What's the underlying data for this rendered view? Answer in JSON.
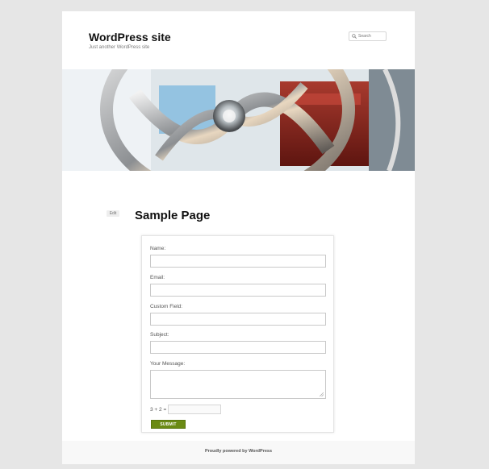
{
  "header": {
    "site_title": "WordPress site",
    "site_description": "Just another WordPress site",
    "search_placeholder": "Search"
  },
  "banner": {
    "icon": "header-image-wheel"
  },
  "content": {
    "edit_label": "Edit",
    "page_title": "Sample Page"
  },
  "form": {
    "name_label": "Name:",
    "email_label": "Email:",
    "custom_label": "Custom Field:",
    "subject_label": "Subject:",
    "message_label": "Your Message:",
    "captcha_label": "3 + 2 =",
    "submit_label": "SUBMIT"
  },
  "footer": {
    "text": "Proudly powered by WordPress"
  },
  "colors": {
    "background": "#e6e6e6",
    "submit": "#6a8a13",
    "text": "#373737"
  }
}
